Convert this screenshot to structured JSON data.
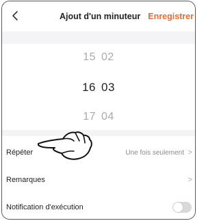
{
  "header": {
    "back_icon": "chevron-left-icon",
    "title": "Ajout d'un minuteur",
    "save_label": "Enregistrer",
    "save_color": "#ee6a2e"
  },
  "time_picker": {
    "rows": [
      {
        "hour": "15",
        "minute": "02",
        "state": "unselected"
      },
      {
        "hour": "16",
        "minute": "03",
        "state": "selected"
      },
      {
        "hour": "17",
        "minute": "04",
        "state": "unselected"
      }
    ]
  },
  "settings": {
    "repeat": {
      "label": "Répéter",
      "value": "Une fois seulement",
      "chevron": ">"
    },
    "notes": {
      "label": "Remarques",
      "chevron": ">"
    },
    "notification": {
      "label": "Notification d'exécution",
      "toggle_on": false
    }
  },
  "overlay": {
    "pointer_icon": "pointing-hand-icon"
  }
}
